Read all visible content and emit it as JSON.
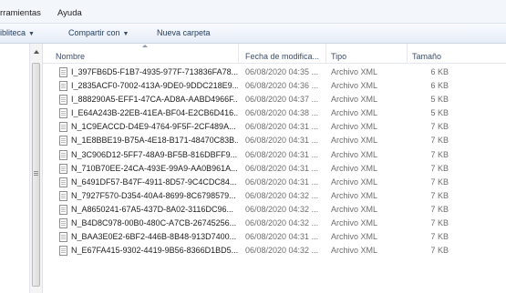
{
  "menu": {
    "items": [
      "rramientas",
      "Ayuda"
    ]
  },
  "toolbar": {
    "library_label": "ibliteca",
    "share_label": "Compartir con",
    "new_folder_label": "Nueva carpeta"
  },
  "columns": {
    "name": "Nombre",
    "date": "Fecha de modifica...",
    "type": "Tipo",
    "size": "Tamaño"
  },
  "files": [
    {
      "name": "I_397FB6D5-F1B7-4935-977F-713836FA78...",
      "date": "06/08/2020 04:35 ...",
      "type": "Archivo XML",
      "size": "6 KB"
    },
    {
      "name": "I_2835ACF0-7002-413A-9DE0-9DDC218E9...",
      "date": "06/08/2020 04:36 ...",
      "type": "Archivo XML",
      "size": "6 KB"
    },
    {
      "name": "I_888290A5-EFF1-47CA-AD8A-AABD4966F...",
      "date": "06/08/2020 04:37 ...",
      "type": "Archivo XML",
      "size": "5 KB"
    },
    {
      "name": "I_E64A243B-22EB-41EA-BF04-E2CB6D416...",
      "date": "06/08/2020 04:38 ...",
      "type": "Archivo XML",
      "size": "5 KB"
    },
    {
      "name": "N_1C9EACCD-D4E9-4764-9F5F-2CF489A...",
      "date": "06/08/2020 04:31 ...",
      "type": "Archivo XML",
      "size": "7 KB"
    },
    {
      "name": "N_1E8BBE19-B75A-4E18-B171-48470C83B...",
      "date": "06/08/2020 04:31 ...",
      "type": "Archivo XML",
      "size": "7 KB"
    },
    {
      "name": "N_3C906D12-5FF7-48A9-BF5B-816DBFF9...",
      "date": "06/08/2020 04:31 ...",
      "type": "Archivo XML",
      "size": "7 KB"
    },
    {
      "name": "N_710B70EE-24CA-493E-99A9-AA0B961A...",
      "date": "06/08/2020 04:31 ...",
      "type": "Archivo XML",
      "size": "7 KB"
    },
    {
      "name": "N_6491DF57-B47F-4911-8D57-9C4CDC84...",
      "date": "06/08/2020 04:31 ...",
      "type": "Archivo XML",
      "size": "7 KB"
    },
    {
      "name": "N_7927F570-D354-40A4-8699-8C6798579...",
      "date": "06/08/2020 04:32 ...",
      "type": "Archivo XML",
      "size": "7 KB"
    },
    {
      "name": "N_A8650241-67A5-437D-8A02-3116DC96...",
      "date": "06/08/2020 04:32 ...",
      "type": "Archivo XML",
      "size": "7 KB"
    },
    {
      "name": "N_B4D8C978-00B0-480C-A7CB-26745256...",
      "date": "06/08/2020 04:32 ...",
      "type": "Archivo XML",
      "size": "7 KB"
    },
    {
      "name": "N_BAA3E0E2-6BF2-446B-8B48-913D7400...",
      "date": "06/08/2020 04:31 ...",
      "type": "Archivo XML",
      "size": "7 KB"
    },
    {
      "name": "N_E67FA415-9302-4419-9B56-8366D1BD5...",
      "date": "06/08/2020 04:32 ...",
      "type": "Archivo XML",
      "size": "7 KB"
    }
  ]
}
